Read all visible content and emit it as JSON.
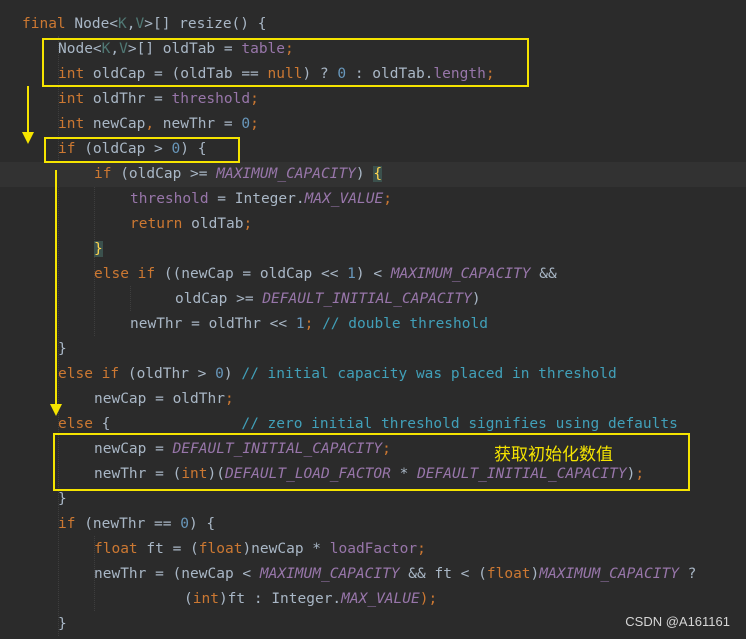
{
  "code": {
    "lines": [
      {
        "indent": 0,
        "tokens": [
          {
            "t": "final ",
            "c": "kw"
          },
          {
            "t": "Node<",
            "c": "type"
          },
          {
            "t": "K",
            "c": "tparam"
          },
          {
            "t": ",",
            "c": "type"
          },
          {
            "t": "V",
            "c": "tparam"
          },
          {
            "t": ">[] resize() {",
            "c": "type"
          }
        ]
      },
      {
        "indent": 1,
        "tokens": [
          {
            "t": "Node<",
            "c": "type"
          },
          {
            "t": "K",
            "c": "tparam"
          },
          {
            "t": ",",
            "c": "type"
          },
          {
            "t": "V",
            "c": "tparam"
          },
          {
            "t": ">[] oldTab = ",
            "c": "type"
          },
          {
            "t": "table",
            "c": "field"
          },
          {
            "t": ";",
            "c": "kw"
          }
        ]
      },
      {
        "indent": 1,
        "tokens": [
          {
            "t": "int ",
            "c": "kw"
          },
          {
            "t": "oldCap = (oldTab == ",
            "c": "type"
          },
          {
            "t": "null",
            "c": "kw"
          },
          {
            "t": ") ? ",
            "c": "type"
          },
          {
            "t": "0",
            "c": "num"
          },
          {
            "t": " : oldTab.",
            "c": "type"
          },
          {
            "t": "length",
            "c": "field"
          },
          {
            "t": ";",
            "c": "kw"
          }
        ]
      },
      {
        "indent": 1,
        "tokens": [
          {
            "t": "int ",
            "c": "kw"
          },
          {
            "t": "oldThr = ",
            "c": "type"
          },
          {
            "t": "threshold",
            "c": "field"
          },
          {
            "t": ";",
            "c": "kw"
          }
        ]
      },
      {
        "indent": 1,
        "tokens": [
          {
            "t": "int ",
            "c": "kw"
          },
          {
            "t": "newCap",
            "c": "type"
          },
          {
            "t": ", ",
            "c": "kw"
          },
          {
            "t": "newThr = ",
            "c": "type"
          },
          {
            "t": "0",
            "c": "num"
          },
          {
            "t": ";",
            "c": "kw"
          }
        ]
      },
      {
        "indent": 1,
        "tokens": [
          {
            "t": "if ",
            "c": "kw"
          },
          {
            "t": "(oldCap > ",
            "c": "type"
          },
          {
            "t": "0",
            "c": "num"
          },
          {
            "t": ") {",
            "c": "type"
          }
        ]
      },
      {
        "indent": 2,
        "current": true,
        "tokens": [
          {
            "t": "if ",
            "c": "kw"
          },
          {
            "t": "(oldCap >= ",
            "c": "type"
          },
          {
            "t": "MAXIMUM_CAPACITY",
            "c": "const"
          },
          {
            "t": ") ",
            "c": "type"
          },
          {
            "t": "{",
            "c": "brace-hl"
          }
        ]
      },
      {
        "indent": 3,
        "tokens": [
          {
            "t": "threshold",
            "c": "field"
          },
          {
            "t": " = Integer.",
            "c": "type"
          },
          {
            "t": "MAX_VALUE",
            "c": "const"
          },
          {
            "t": ";",
            "c": "kw"
          }
        ]
      },
      {
        "indent": 3,
        "tokens": [
          {
            "t": "return ",
            "c": "kw"
          },
          {
            "t": "oldTab",
            "c": "type"
          },
          {
            "t": ";",
            "c": "kw"
          }
        ]
      },
      {
        "indent": 2,
        "tokens": [
          {
            "t": "}",
            "c": "brace-hl"
          }
        ]
      },
      {
        "indent": 2,
        "tokens": [
          {
            "t": "else if ",
            "c": "kw"
          },
          {
            "t": "((newCap = oldCap << ",
            "c": "type"
          },
          {
            "t": "1",
            "c": "num"
          },
          {
            "t": ") < ",
            "c": "type"
          },
          {
            "t": "MAXIMUM_CAPACITY",
            "c": "const"
          },
          {
            "t": " &&",
            "c": "type"
          }
        ]
      },
      {
        "indent": 4.25,
        "tokens": [
          {
            "t": "oldCap >= ",
            "c": "type"
          },
          {
            "t": "DEFAULT_INITIAL_CAPACITY",
            "c": "const"
          },
          {
            "t": ")",
            "c": "type"
          }
        ]
      },
      {
        "indent": 3,
        "tokens": [
          {
            "t": "newThr = oldThr << ",
            "c": "type"
          },
          {
            "t": "1",
            "c": "num"
          },
          {
            "t": "; ",
            "c": "kw"
          },
          {
            "t": "// double threshold",
            "c": "cm"
          }
        ]
      },
      {
        "indent": 1,
        "tokens": [
          {
            "t": "}",
            "c": "type"
          }
        ]
      },
      {
        "indent": 1,
        "tokens": [
          {
            "t": "else if ",
            "c": "kw"
          },
          {
            "t": "(oldThr > ",
            "c": "type"
          },
          {
            "t": "0",
            "c": "num"
          },
          {
            "t": ") ",
            "c": "type"
          },
          {
            "t": "// initial capacity was placed in threshold",
            "c": "cm"
          }
        ]
      },
      {
        "indent": 2,
        "tokens": [
          {
            "t": "newCap = oldThr",
            "c": "type"
          },
          {
            "t": ";",
            "c": "kw"
          }
        ]
      },
      {
        "indent": 1,
        "tokens": [
          {
            "t": "else ",
            "c": "kw"
          },
          {
            "t": "{               ",
            "c": "type"
          },
          {
            "t": "// zero initial threshold signifies using defaults",
            "c": "cm"
          }
        ]
      },
      {
        "indent": 2,
        "tokens": [
          {
            "t": "newCap = ",
            "c": "type"
          },
          {
            "t": "DEFAULT_INITIAL_CAPACITY",
            "c": "const"
          },
          {
            "t": ";",
            "c": "kw"
          }
        ]
      },
      {
        "indent": 2,
        "tokens": [
          {
            "t": "newThr = (",
            "c": "type"
          },
          {
            "t": "int",
            "c": "kw"
          },
          {
            "t": ")(",
            "c": "type"
          },
          {
            "t": "DEFAULT_LOAD_FACTOR",
            "c": "const"
          },
          {
            "t": " * ",
            "c": "type"
          },
          {
            "t": "DEFAULT_INITIAL_CAPACITY",
            "c": "const"
          },
          {
            "t": ")",
            "c": "type"
          },
          {
            "t": ";",
            "c": "kw"
          }
        ]
      },
      {
        "indent": 1,
        "tokens": [
          {
            "t": "}",
            "c": "type"
          }
        ]
      },
      {
        "indent": 1,
        "tokens": [
          {
            "t": "if ",
            "c": "kw"
          },
          {
            "t": "(newThr == ",
            "c": "type"
          },
          {
            "t": "0",
            "c": "num"
          },
          {
            "t": ") {",
            "c": "type"
          }
        ]
      },
      {
        "indent": 2,
        "tokens": [
          {
            "t": "float ",
            "c": "kw"
          },
          {
            "t": "ft = (",
            "c": "type"
          },
          {
            "t": "float",
            "c": "kw"
          },
          {
            "t": ")newCap * ",
            "c": "type"
          },
          {
            "t": "loadFactor",
            "c": "field"
          },
          {
            "t": ";",
            "c": "kw"
          }
        ]
      },
      {
        "indent": 2,
        "tokens": [
          {
            "t": "newThr = (newCap < ",
            "c": "type"
          },
          {
            "t": "MAXIMUM_CAPACITY",
            "c": "const"
          },
          {
            "t": " && ft < (",
            "c": "type"
          },
          {
            "t": "float",
            "c": "kw"
          },
          {
            "t": ")",
            "c": "type"
          },
          {
            "t": "MAXIMUM_CAPACITY",
            "c": "const"
          },
          {
            "t": " ?",
            "c": "type"
          }
        ]
      },
      {
        "indent": 4.5,
        "tokens": [
          {
            "t": "(",
            "c": "type"
          },
          {
            "t": "int",
            "c": "kw"
          },
          {
            "t": ")ft : Integer.",
            "c": "type"
          },
          {
            "t": "MAX_VALUE",
            "c": "const"
          },
          {
            "t": ");",
            "c": "kw"
          }
        ]
      },
      {
        "indent": 1,
        "tokens": [
          {
            "t": "}",
            "c": "type"
          }
        ]
      }
    ]
  },
  "annotation": {
    "text": "获取初始化数值"
  },
  "watermark": {
    "text": "CSDN @A161161"
  }
}
